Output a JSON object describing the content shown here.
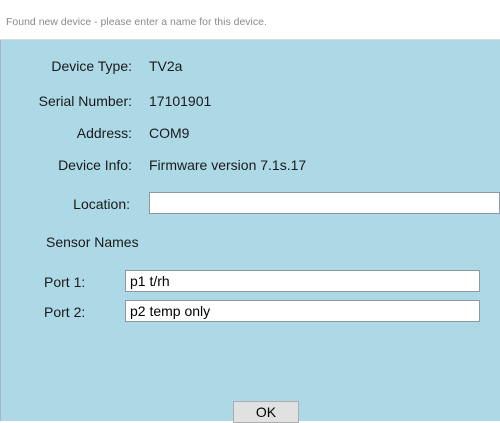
{
  "dialog": {
    "title": "Found new device - please enter a name for this device."
  },
  "device": {
    "type_label": "Device Type:",
    "type_value": "TV2a",
    "serial_label": "Serial Number:",
    "serial_value": "17101901",
    "address_label": "Address:",
    "address_value": "COM9",
    "info_label": "Device Info:",
    "info_value": "Firmware version 7.1s.17"
  },
  "location": {
    "label": "Location:",
    "value": ""
  },
  "sensors": {
    "section_title": "Sensor Names",
    "ports": [
      {
        "label": "Port 1:",
        "value": "p1 t/rh"
      },
      {
        "label": "Port 2:",
        "value": "p2 temp only"
      }
    ]
  },
  "actions": {
    "ok_label": "OK"
  },
  "colors": {
    "dialog_background": "#add8e6",
    "title_text": "#8a8a8a"
  }
}
